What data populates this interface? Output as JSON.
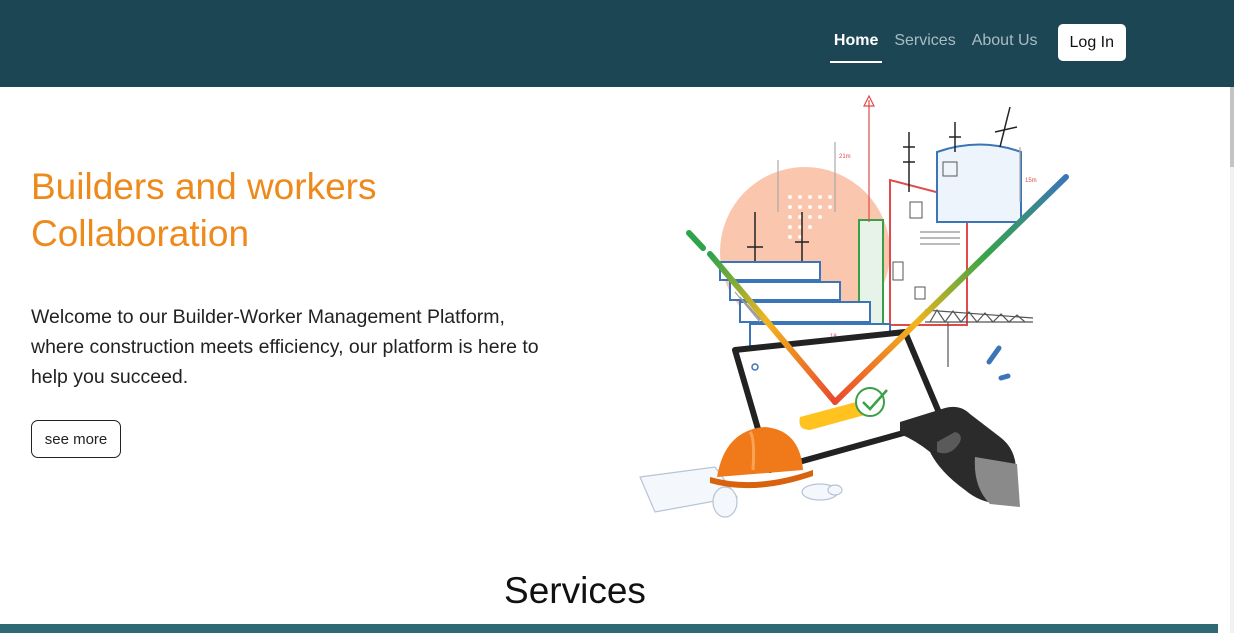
{
  "nav": {
    "links": [
      "Home",
      "Services",
      "About Us"
    ],
    "login_label": "Log In",
    "bg_color": "#1d4655"
  },
  "hero": {
    "title": "Builders and workers Collaboration",
    "text": "Welcome to our Builder-Worker Management Platform, where construction meets efficiency, our platform is here to help you succeed.",
    "button_label": "see more",
    "title_color": "#ee8a1b"
  },
  "services": {
    "title": "Services"
  },
  "illustration": {
    "labels": [
      "21m",
      "15m",
      "18"
    ]
  }
}
